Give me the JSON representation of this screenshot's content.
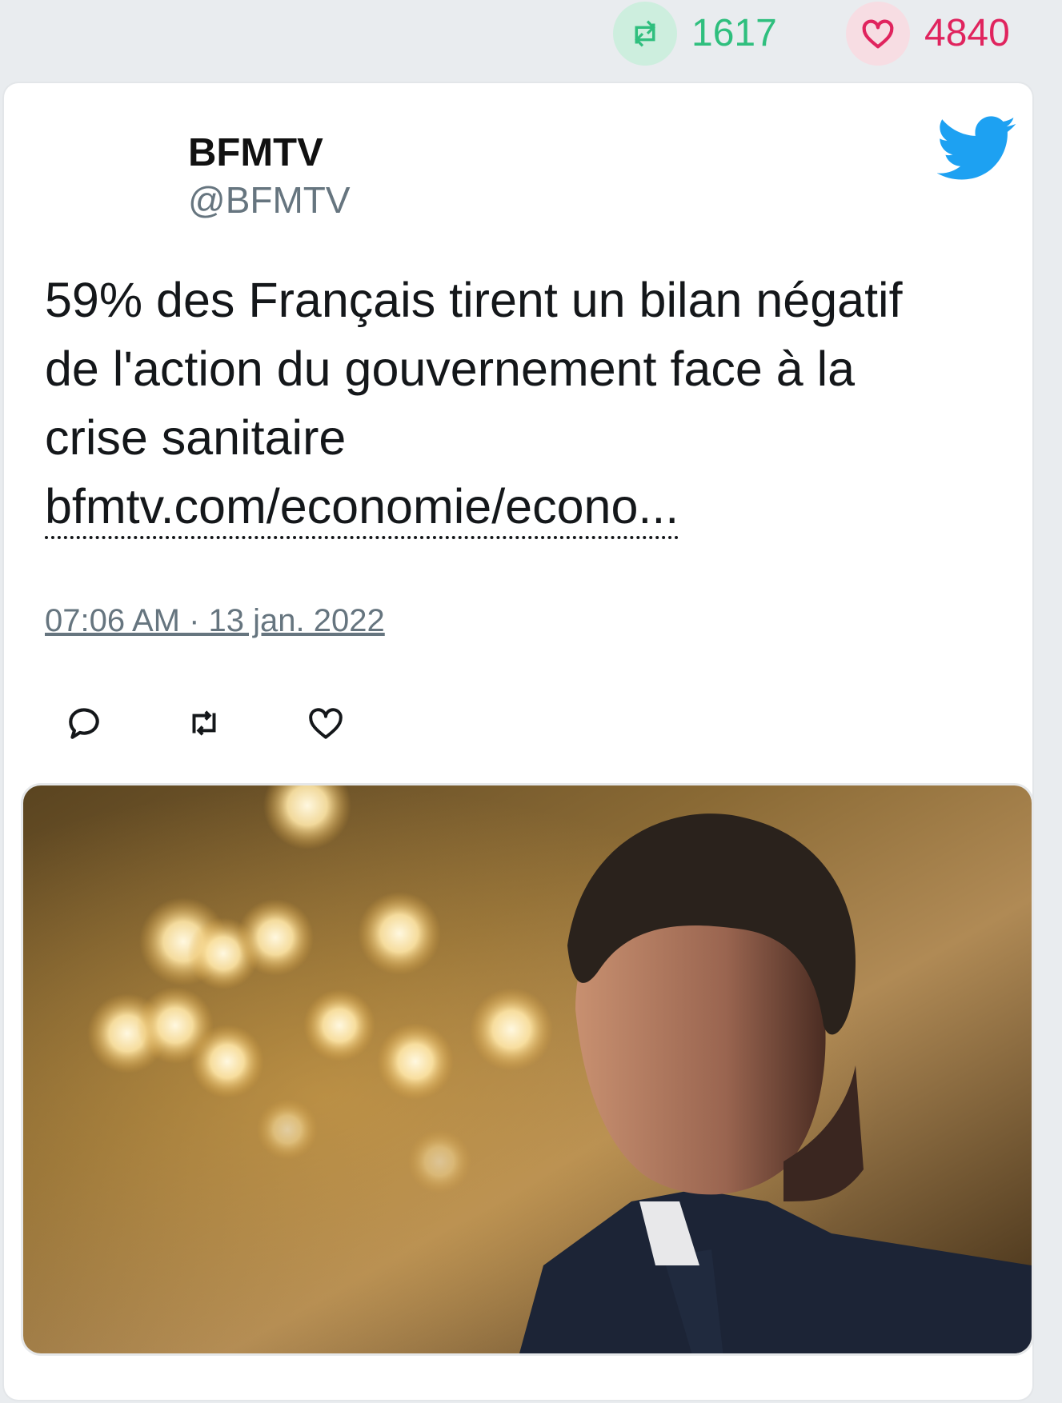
{
  "stats": {
    "retweets": "1617",
    "likes": "4840"
  },
  "tweet": {
    "author_name": "BFMTV",
    "author_handle": "@BFMTV",
    "text_lines": [
      "59% des Français tirent un bilan négatif",
      "de l'action du gouvernement face à la",
      "crise sanitaire"
    ],
    "link": "bfmtv.com/economie/econo...",
    "timestamp": "07:06 AM · 13 jan. 2022"
  },
  "icons": {
    "brand": "twitter-bird-icon",
    "actions": [
      "reply-icon",
      "retweet-icon",
      "like-icon"
    ]
  },
  "colors": {
    "retweet": "#2fbf7e",
    "like": "#e0245e",
    "twitter_blue": "#1da1f2",
    "muted_text": "#66757f"
  }
}
